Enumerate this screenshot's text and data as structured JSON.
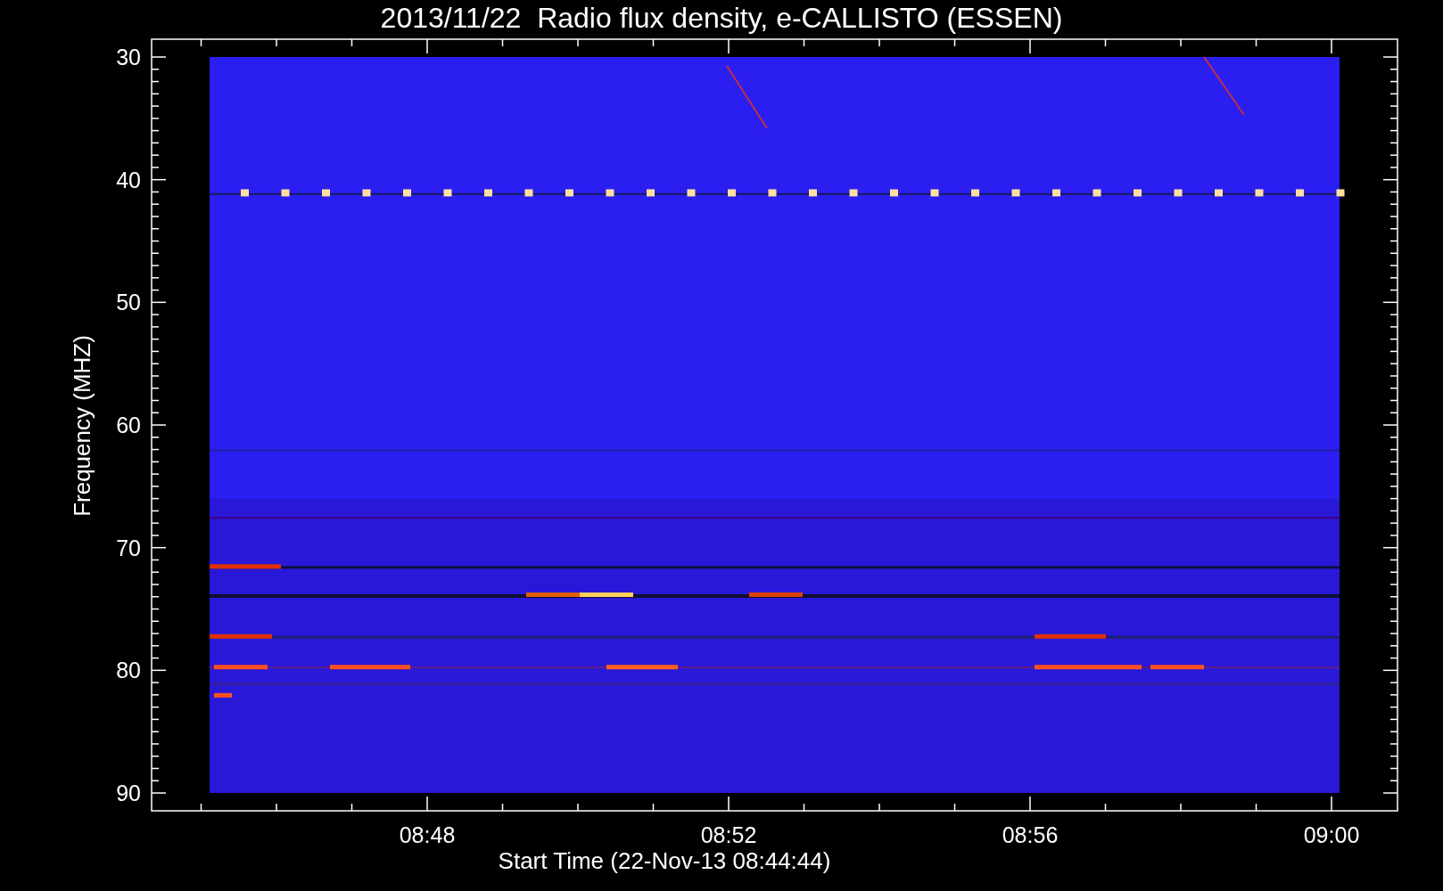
{
  "title": "2013/11/22  Radio flux density, e-CALLISTO (ESSEN)",
  "y_axis": {
    "label": "Frequency (MHZ)",
    "ticks": [
      "30",
      "40",
      "50",
      "60",
      "70",
      "80",
      "90"
    ]
  },
  "x_axis": {
    "label": "Start Time (22-Nov-13 08:44:44)",
    "ticks": [
      "08:48",
      "08:52",
      "08:56",
      "09:00"
    ]
  }
}
